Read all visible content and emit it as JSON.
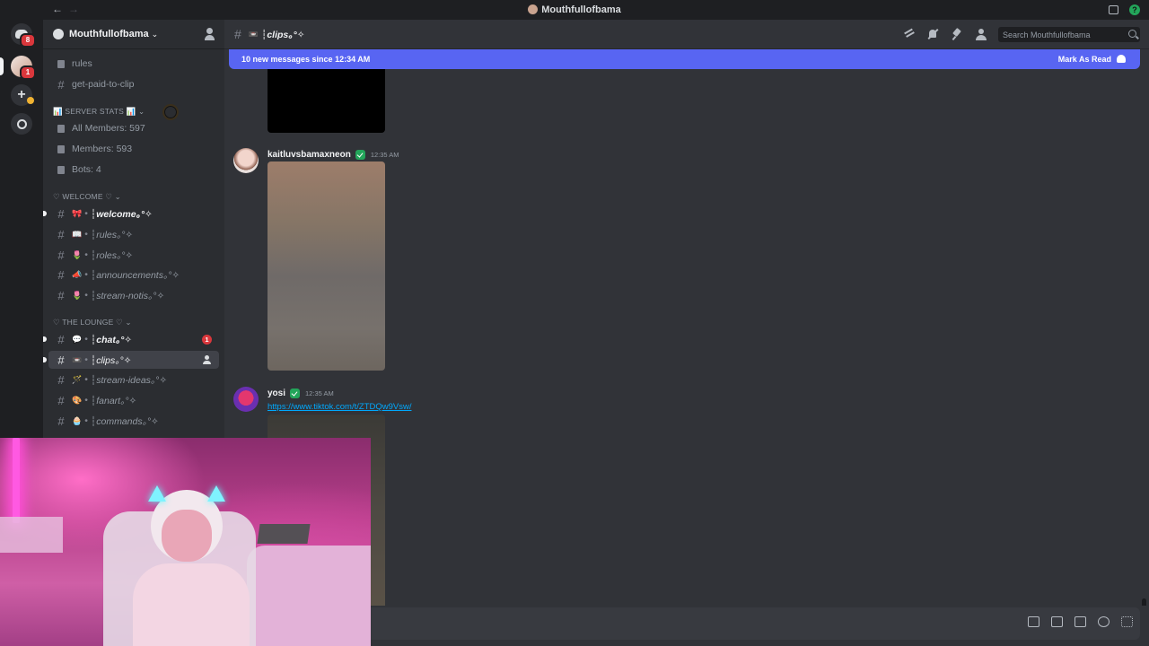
{
  "titlebar": {
    "title": "Mouthfullofbama",
    "back": "←",
    "forward": "→",
    "help": "?"
  },
  "rail": {
    "dm_badge": "8",
    "server_badge": "1",
    "add_label": "+"
  },
  "server": {
    "name": "Mouthfullofbama",
    "chevron": "⌄"
  },
  "channels": {
    "rules": "rules",
    "get_paid": "get-paid-to-clip",
    "cat_server_stats": "📊 SERVER STATS 📊 ⌄",
    "all_members": "All Members: 597",
    "members": "Members: 593",
    "bots": "Bots: 4",
    "cat_welcome": "♡ WELCOME ♡ ⌄",
    "welcome": {
      "emoji": "🎀",
      "label": "┆welcome｡°✧"
    },
    "rules2": {
      "emoji": "📖",
      "label": "┆rules｡°✧"
    },
    "roles": {
      "emoji": "🌷",
      "label": "┆roles｡°✧"
    },
    "announcements": {
      "emoji": "📣",
      "label": "┆announcements｡°✧"
    },
    "stream_notis": {
      "emoji": "🌷",
      "label": "┆stream-notis｡°✧"
    },
    "cat_lounge": "♡ THE LOUNGE ♡ ⌄",
    "chat": {
      "emoji": "💬",
      "label": "┆chat｡°✧",
      "mentions": "1"
    },
    "clips": {
      "emoji": "📼",
      "label": "┆clips｡°✧"
    },
    "stream_ideas": {
      "emoji": "🪄",
      "label": "┆stream-ideas｡°✧"
    },
    "fanart": {
      "emoji": "🎨",
      "label": "┆fanart｡°✧"
    },
    "commands": {
      "emoji": "🧁",
      "label": "┆commands｡°✧"
    }
  },
  "chat_header": {
    "emoji": "📼",
    "title": "┆clips｡°✧",
    "search_placeholder": "Search Mouthfullofbama"
  },
  "banner": {
    "text": "10 new messages since 12:34 AM",
    "mark_read": "Mark As Read"
  },
  "messages": [
    {
      "author": "kaitluvsbamaxneon",
      "time": "12:35 AM"
    },
    {
      "author": "yosi",
      "time": "12:35 AM",
      "link": "https://www.tiktok.com/t/ZTDQw9Vsw/"
    }
  ],
  "colors": {
    "blurple": "#5865f2",
    "link": "#00a8fc",
    "mention_red": "#da373c",
    "verified_green": "#23a55a"
  }
}
